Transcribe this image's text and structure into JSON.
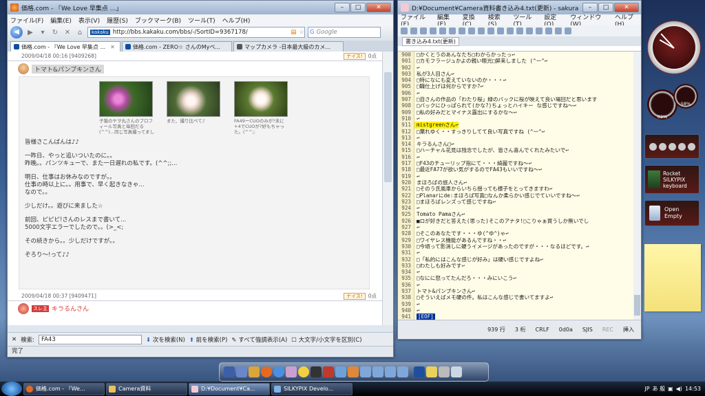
{
  "firefox": {
    "title": "価格.com - 『We Love 早集点 ...」",
    "menu": [
      "ファイル(F)",
      "編集(E)",
      "表示(V)",
      "履歴(S)",
      "ブックマーク(B)",
      "ツール(T)",
      "ヘルプ(H)"
    ],
    "url": "http://bbs.kakaku.com/bbs/-/SortID=9367178/",
    "url_site": "kakaku",
    "search_placeholder": "Google",
    "tabs": [
      "価格.com - 『We Love 早集点 ...",
      "価格.com - ZERO☆ さんのMyペ...",
      "マップカメラ -日本最大級のカメ..."
    ],
    "post1_meta": "2009/04/18 00:16 [9409268]",
    "nice_label": "ナイス!",
    "nice_count": "0点",
    "post_author": "トマト&パンプキンさん",
    "photo_captions": [
      "子猫のヤヲ丸さんのプロフィール写真と毎回だる(^^)...同じ写真撮ってました",
      "また、撮り比べて♪",
      "FA49ーCUOのみが?未に+4でCUOが?好もちゃった。(^^;;"
    ],
    "post_lines": [
      "皆様さこんばんは♪♪",
      "一昨日、やっと追いついたのに。。",
      "昨晩。。パンツキューで、また一日遅れの私です。(^^;;...",
      "明日、仕事はお休みなのですが。。",
      "仕事の時以上に。。用事で、早く起きなきゃ...",
      "なので。。",
      "少しだけ。。遊びに来ました☆",
      "前回、ピピピ!さんのレスまで書いて...",
      "5000文字エラーでしたので。。(>_<;",
      "その続きから。。少しだけですが。。",
      "ぞろり～!って♪♪"
    ],
    "post2_meta": "2009/04/18 00:37 [9409471]",
    "next_author_tag": "スレ主",
    "next_author": "キラるんさん",
    "find_label": "検索:",
    "find_value": "FA43",
    "find_next": "次を検索(N)",
    "find_prev": "前を検索(P)",
    "find_highlight": "すべて強調表示(A)",
    "find_case": "大文字/小文字を区別(C)",
    "status": "完了"
  },
  "sakura": {
    "title": "D:¥Document¥Camera資料書き込み4.txt(更新) - sakura 1.6.3.0",
    "menu": [
      "ファイル(F)",
      "編集(E)",
      "変換(C)",
      "検索(S)",
      "ツール(T)",
      "設定(O)",
      "ウィンドウ(W)",
      "ヘルプ(H)"
    ],
    "doctab": "書き込み4.txt(更新)",
    "lines": [
      {
        "no": "900",
        "text": "□かくとうのあんなたち□わからかったっ↩"
      },
      {
        "no": "901",
        "text": "□カモフラージュかよの親い眼光□屏来しました (^ー^↩"
      },
      {
        "no": "902",
        "text": "↩"
      },
      {
        "no": "903",
        "text": "私が3人目さん↩"
      },
      {
        "no": "904",
        "text": "□特になにも変えていないのか・・・↩"
      },
      {
        "no": "905",
        "text": "□職仕上げは何からですか?↩"
      },
      {
        "no": "906",
        "text": "↩"
      },
      {
        "no": "907",
        "text": "□自さんの作品の「わたり桜」緑のバックに桜が映えて良い場回だと思います"
      },
      {
        "no": "908",
        "text": "□バックにひっぱられて(かな?)ちょっとハイキー な感じですね〜↩"
      },
      {
        "no": "909",
        "text": "□私の好みだとマイナス露出にするかな〜↩"
      },
      {
        "no": "910",
        "text": "↩"
      },
      {
        "no": "911",
        "text": "mistgreenさん↩",
        "hl": true
      },
      {
        "no": "912",
        "text": "□葉れゆく・・すっきりしてて良い写真ですね (^ー^↩"
      },
      {
        "no": "913",
        "text": "↩"
      },
      {
        "no": "914",
        "text": "キラるんさん□↩"
      },
      {
        "no": "915",
        "text": "□ハーチャル花見は残念でしたが、皆さん喜んでくれたみたいで↩"
      },
      {
        "no": "916",
        "text": "↩"
      },
      {
        "no": "917",
        "text": "□F43のチューリップ指にて・・・綺麗ですね〜↩"
      },
      {
        "no": "918",
        "text": "□最近FA77が欲い気がするのでFA43もいいですね〜↩"
      },
      {
        "no": "919",
        "text": "↩"
      },
      {
        "no": "920",
        "text": "まほろばの旅人さん↩"
      },
      {
        "no": "921",
        "text": "□そのう氏風車からいちら揺っても様子をとってきますわ↩"
      },
      {
        "no": "922",
        "text": "□Planarにde:まほろば写真□なんか柔らかい感じでていいですね〜↩"
      },
      {
        "no": "923",
        "text": "□まほろばレンズって感じですね↩"
      },
      {
        "no": "924",
        "text": "↩"
      },
      {
        "no": "925",
        "text": "Tomato Pamaさん↩"
      },
      {
        "no": "926",
        "text": "■ロが好きだと答えた(思った)そこのアナタ!□こりゃぁ買うしか無いでし"
      },
      {
        "no": "927",
        "text": "↩"
      },
      {
        "no": "928",
        "text": "□そこのあなたです・・・ゆ(^ゆ^)ゃ↩"
      },
      {
        "no": "929",
        "text": "□ワイヤレス機能があるんですね・・↩"
      },
      {
        "no": "930",
        "text": "□今頃って影消しに硬うイメージがあったのですが・・・なるほどです。↩"
      },
      {
        "no": "931",
        "text": "↩"
      },
      {
        "no": "932",
        "text": "□「私的にはこんな感じが好み」は硬い感じですよね↩"
      },
      {
        "no": "933",
        "text": "□わたしも好みです↩"
      },
      {
        "no": "934",
        "text": "↩"
      },
      {
        "no": "935",
        "text": "□なにに怒ってたんだろ・・・みにいこう↩"
      },
      {
        "no": "936",
        "text": "↩"
      },
      {
        "no": "937",
        "text": "トマト&パンプキンさん↩"
      },
      {
        "no": "938",
        "text": "□そういえばメモ硬の件。私はこんな感じで書いてますよ↩"
      },
      {
        "no": "939",
        "text": "↩"
      },
      {
        "no": "940",
        "text": "↩"
      },
      {
        "no": "941",
        "text": "[EOF]",
        "eof": true
      }
    ],
    "status": [
      "939 行",
      "3 桁",
      "CRLF",
      "0d0a",
      "SJIS",
      "REC",
      "挿入"
    ]
  },
  "sidebar": {
    "cpu_label": "02%",
    "mem_label": "58%",
    "rocket_label": "Rocket SILKYPIX keyboard",
    "recycle_label": "Open Empty"
  },
  "taskbar": {
    "buttons": [
      "価格.com - 『We...",
      "Camera資料",
      "D:¥Document¥Ca...",
      "SILKYPIX Develo..."
    ],
    "lang": "JP",
    "ime": "あ 般",
    "time": "14:53"
  }
}
